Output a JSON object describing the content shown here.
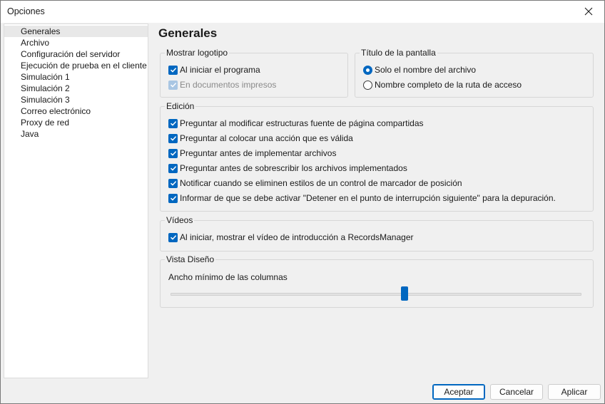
{
  "window": {
    "title": "Opciones"
  },
  "nav": {
    "items": [
      {
        "label": "Generales",
        "selected": true
      },
      {
        "label": "Archivo"
      },
      {
        "label": "Configuración del servidor"
      },
      {
        "label": "Ejecución de prueba en el cliente"
      },
      {
        "label": "Simulación 1"
      },
      {
        "label": "Simulación 2"
      },
      {
        "label": "Simulación 3"
      },
      {
        "label": "Correo electrónico"
      },
      {
        "label": "Proxy de red"
      },
      {
        "label": "Java"
      }
    ]
  },
  "page": {
    "heading": "Generales",
    "logo_group": {
      "label": "Mostrar logotipo",
      "options": [
        {
          "label": "Al iniciar el programa",
          "checked": true,
          "enabled": true
        },
        {
          "label": "En documentos impresos",
          "checked": true,
          "enabled": false
        }
      ]
    },
    "title_group": {
      "label": "Título de la pantalla",
      "options": [
        {
          "label": "Solo el nombre del archivo",
          "selected": true
        },
        {
          "label": "Nombre completo de la ruta de acceso",
          "selected": false
        }
      ]
    },
    "edit_group": {
      "label": "Edición",
      "options": [
        {
          "label": "Preguntar al modificar estructuras fuente de página compartidas",
          "checked": true
        },
        {
          "label": "Preguntar al colocar una acción que es válida",
          "checked": true
        },
        {
          "label": "Preguntar antes de implementar archivos",
          "checked": true
        },
        {
          "label": "Preguntar antes de sobrescribir los archivos implementados",
          "checked": true
        },
        {
          "label": "Notificar cuando se eliminen estilos de un control de marcador de posición",
          "checked": true
        },
        {
          "label": "Informar de que se debe activar \"Detener en el punto de interrupción siguiente\" para la depuración.",
          "checked": true
        }
      ]
    },
    "videos_group": {
      "label": "Vídeos",
      "options": [
        {
          "label": "Al iniciar, mostrar el vídeo de introducción a RecordsManager",
          "checked": true
        }
      ]
    },
    "design_group": {
      "label": "Vista Diseño",
      "slider_label": "Ancho mínimo de las columnas",
      "slider_value_fraction": 0.57
    }
  },
  "buttons": {
    "accept": "Aceptar",
    "cancel": "Cancelar",
    "apply": "Aplicar"
  },
  "colors": {
    "accent": "#0067c0"
  }
}
